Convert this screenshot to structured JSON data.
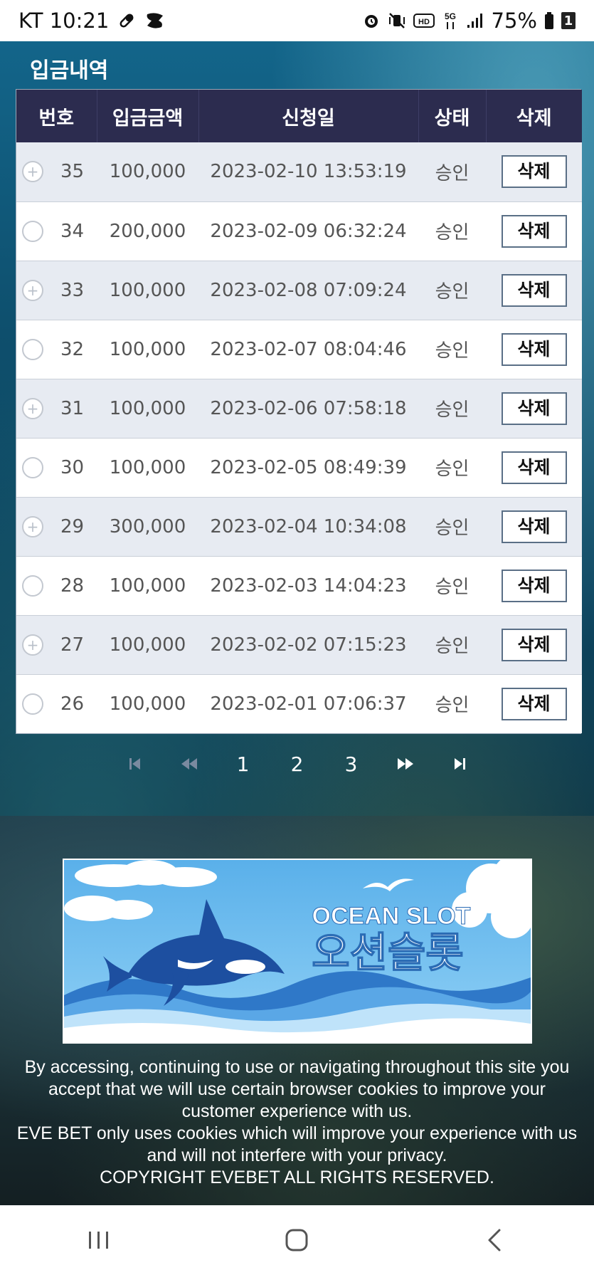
{
  "status_bar": {
    "carrier_time": "KT 10:21",
    "battery_percent": "75%",
    "battery_badge": "1",
    "hd_label": "HD",
    "network_label": "5G"
  },
  "page": {
    "title": "입금내역"
  },
  "table": {
    "headers": {
      "number": "번호",
      "amount": "입금금액",
      "date": "신청일",
      "status": "상태",
      "delete": "삭제"
    },
    "rows": [
      {
        "number": "35",
        "amount": "100,000",
        "date": "2023-02-10 13:53:19",
        "status": "승인",
        "delete_label": "삭제",
        "toggle": "+"
      },
      {
        "number": "34",
        "amount": "200,000",
        "date": "2023-02-09 06:32:24",
        "status": "승인",
        "delete_label": "삭제",
        "toggle": ""
      },
      {
        "number": "33",
        "amount": "100,000",
        "date": "2023-02-08 07:09:24",
        "status": "승인",
        "delete_label": "삭제",
        "toggle": "+"
      },
      {
        "number": "32",
        "amount": "100,000",
        "date": "2023-02-07 08:04:46",
        "status": "승인",
        "delete_label": "삭제",
        "toggle": ""
      },
      {
        "number": "31",
        "amount": "100,000",
        "date": "2023-02-06 07:58:18",
        "status": "승인",
        "delete_label": "삭제",
        "toggle": "+"
      },
      {
        "number": "30",
        "amount": "100,000",
        "date": "2023-02-05 08:49:39",
        "status": "승인",
        "delete_label": "삭제",
        "toggle": ""
      },
      {
        "number": "29",
        "amount": "300,000",
        "date": "2023-02-04 10:34:08",
        "status": "승인",
        "delete_label": "삭제",
        "toggle": "+"
      },
      {
        "number": "28",
        "amount": "100,000",
        "date": "2023-02-03 14:04:23",
        "status": "승인",
        "delete_label": "삭제",
        "toggle": ""
      },
      {
        "number": "27",
        "amount": "100,000",
        "date": "2023-02-02 07:15:23",
        "status": "승인",
        "delete_label": "삭제",
        "toggle": "+"
      },
      {
        "number": "26",
        "amount": "100,000",
        "date": "2023-02-01 07:06:37",
        "status": "승인",
        "delete_label": "삭제",
        "toggle": ""
      }
    ]
  },
  "pagination": {
    "first_icon": "first-page-icon",
    "prev_icon": "previous-page-icon",
    "pages": [
      "1",
      "2",
      "3"
    ],
    "next_icon": "next-page-icon",
    "last_icon": "last-page-icon"
  },
  "banner": {
    "title_en": "OCEAN SLOT",
    "title_ko": "오션슬롯"
  },
  "footer": {
    "line1": "By accessing, continuing to use or navigating throughout this site you",
    "line2": "accept that we will use certain browser cookies to improve your",
    "line3": "customer experience with us.",
    "line4": "EVE BET only uses cookies which will improve your experience with us",
    "line5": "and will not interfere with your privacy.",
    "line6": "COPYRIGHT EVEBET ALL RIGHTS RESERVED."
  },
  "colors": {
    "header_bg": "#2c2c4f",
    "row_alt_bg": "#e7ebf2",
    "button_border": "#5a6f86"
  }
}
